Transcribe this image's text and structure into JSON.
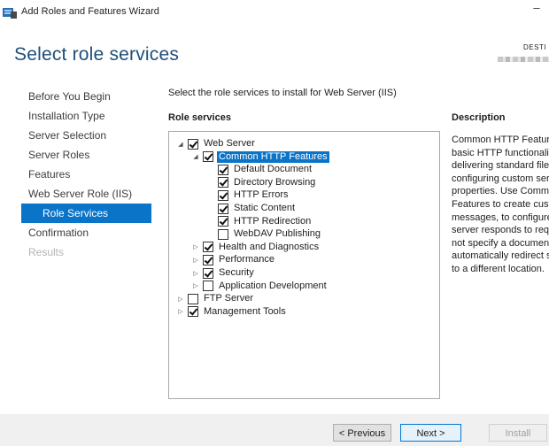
{
  "window": {
    "title": "Add Roles and Features Wizard",
    "minimize_glyph": "–"
  },
  "header": {
    "page_title": "Select role services",
    "destination_label": "DESTI"
  },
  "nav": {
    "items": [
      {
        "label": "Before You Begin",
        "state": "normal"
      },
      {
        "label": "Installation Type",
        "state": "normal"
      },
      {
        "label": "Server Selection",
        "state": "normal"
      },
      {
        "label": "Server Roles",
        "state": "normal"
      },
      {
        "label": "Features",
        "state": "normal"
      },
      {
        "label": "Web Server Role (IIS)",
        "state": "normal"
      },
      {
        "label": "Role Services",
        "state": "active"
      },
      {
        "label": "Confirmation",
        "state": "normal"
      },
      {
        "label": "Results",
        "state": "disabled"
      }
    ]
  },
  "main": {
    "instruction": "Select the role services to install for Web Server (IIS)",
    "role_services_label": "Role services",
    "tree": [
      {
        "label": "Web Server",
        "level": 0,
        "expander": "expanded",
        "checked": true,
        "selected": false
      },
      {
        "label": "Common HTTP Features",
        "level": 1,
        "expander": "expanded",
        "checked": true,
        "selected": true
      },
      {
        "label": "Default Document",
        "level": 2,
        "expander": "none",
        "checked": true,
        "selected": false
      },
      {
        "label": "Directory Browsing",
        "level": 2,
        "expander": "none",
        "checked": true,
        "selected": false
      },
      {
        "label": "HTTP Errors",
        "level": 2,
        "expander": "none",
        "checked": true,
        "selected": false
      },
      {
        "label": "Static Content",
        "level": 2,
        "expander": "none",
        "checked": true,
        "selected": false
      },
      {
        "label": "HTTP Redirection",
        "level": 2,
        "expander": "none",
        "checked": true,
        "selected": false
      },
      {
        "label": "WebDAV Publishing",
        "level": 2,
        "expander": "none",
        "checked": false,
        "selected": false
      },
      {
        "label": "Health and Diagnostics",
        "level": 1,
        "expander": "collapsed",
        "checked": true,
        "selected": false
      },
      {
        "label": "Performance",
        "level": 1,
        "expander": "collapsed",
        "checked": true,
        "selected": false
      },
      {
        "label": "Security",
        "level": 1,
        "expander": "collapsed",
        "checked": true,
        "selected": false
      },
      {
        "label": "Application Development",
        "level": 1,
        "expander": "collapsed",
        "checked": false,
        "selected": false
      },
      {
        "label": "FTP Server",
        "level": 0,
        "expander": "collapsed",
        "checked": false,
        "selected": false
      },
      {
        "label": "Management Tools",
        "level": 0,
        "expander": "collapsed",
        "checked": true,
        "selected": false
      }
    ]
  },
  "description": {
    "label": "Description",
    "lines": [
      "Common HTTP Feature",
      "basic HTTP functionalit",
      "delivering standard file",
      "configuring custom ser",
      "properties. Use Commo",
      "Features to create custo",
      "messages, to configure",
      "server responds to requ",
      "not specify a document",
      "automatically redirect s",
      "to a different location."
    ]
  },
  "footer": {
    "previous_label": "< Previous",
    "next_label": "Next >",
    "install_label": "Install"
  },
  "icons": {
    "expanded": "◢",
    "collapsed": "▷"
  },
  "colors": {
    "accent": "#0a74c8",
    "title": "#1f4e79"
  }
}
